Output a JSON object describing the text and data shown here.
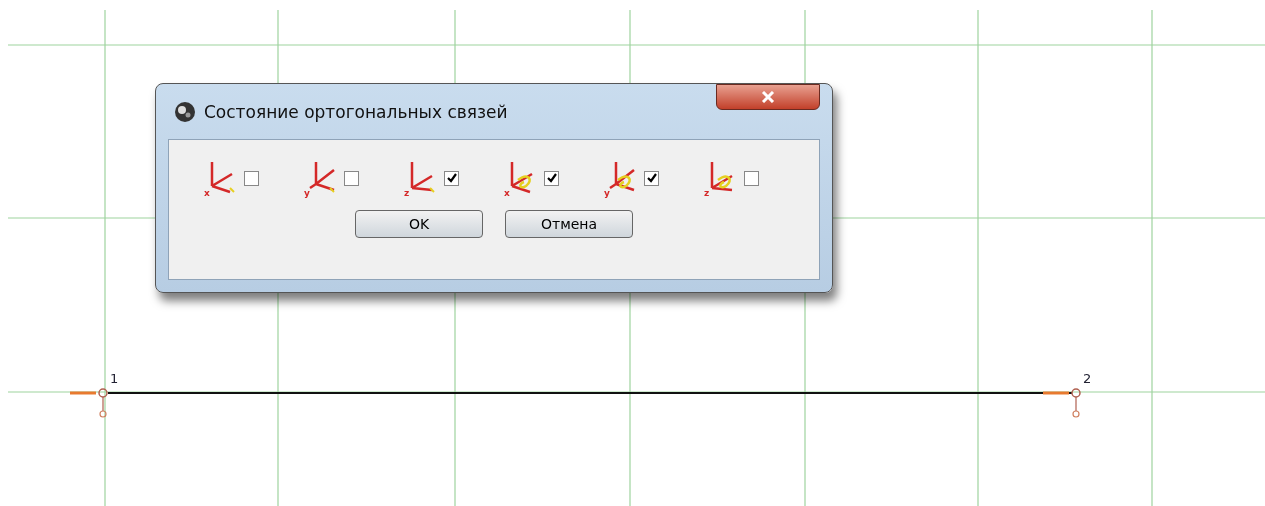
{
  "dialog": {
    "title": "Состояние ортогональных связей",
    "constraints": [
      {
        "kind": "translation",
        "axis": "x",
        "checked": false
      },
      {
        "kind": "translation",
        "axis": "y",
        "checked": false
      },
      {
        "kind": "translation",
        "axis": "z",
        "checked": true
      },
      {
        "kind": "rotation",
        "axis": "x",
        "checked": true
      },
      {
        "kind": "rotation",
        "axis": "y",
        "checked": true
      },
      {
        "kind": "rotation",
        "axis": "z",
        "checked": false
      }
    ],
    "buttons": [
      "OK",
      "Отмена"
    ]
  },
  "nodes": [
    {
      "label": "1"
    },
    {
      "label": "2"
    }
  ]
}
